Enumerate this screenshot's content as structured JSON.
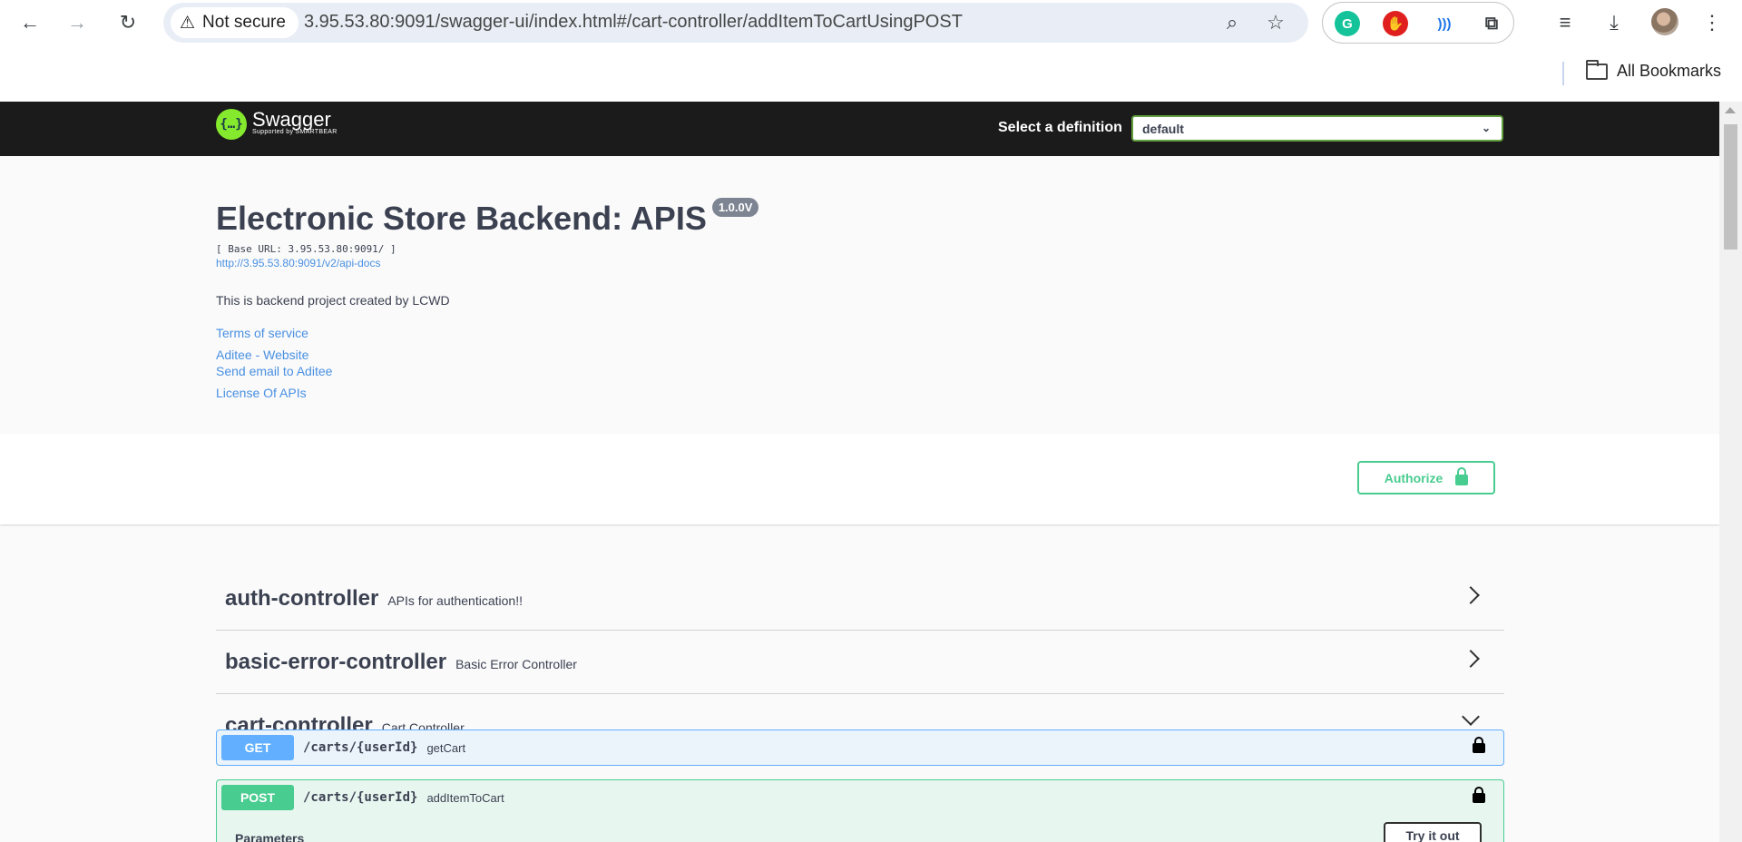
{
  "browser": {
    "security_label": "Not secure",
    "url": "3.95.53.80:9091/swagger-ui/index.html#/cart-controller/addItemToCartUsingPOST",
    "bookmarks_label": "All Bookmarks"
  },
  "topbar": {
    "logo_text": "Swagger",
    "logo_sub": "Supported by SMARTBEAR",
    "definition_label": "Select a definition",
    "definition_value": "default"
  },
  "info": {
    "title": "Electronic Store Backend: APIS",
    "version": "1.0.0V",
    "base_url": "[ Base URL: 3.95.53.80:9091/ ]",
    "api_docs_link": "http://3.95.53.80:9091/v2/api-docs",
    "description": "This is backend project created by LCWD",
    "terms": "Terms of service",
    "website": "Aditee - Website",
    "email": "Send email to Aditee",
    "license": "License Of APIs"
  },
  "authorize_label": "Authorize",
  "tags": [
    {
      "name": "auth-controller",
      "desc": "APIs for authentication!!"
    },
    {
      "name": "basic-error-controller",
      "desc": "Basic Error Controller"
    },
    {
      "name": "cart-controller",
      "desc": "Cart Controller"
    }
  ],
  "operations": [
    {
      "method": "GET",
      "path": "/carts/{userId}",
      "summary": "getCart"
    },
    {
      "method": "POST",
      "path": "/carts/{userId}",
      "summary": "addItemToCart"
    }
  ],
  "op_body": {
    "parameters_label": "Parameters",
    "try_label": "Try it out"
  }
}
